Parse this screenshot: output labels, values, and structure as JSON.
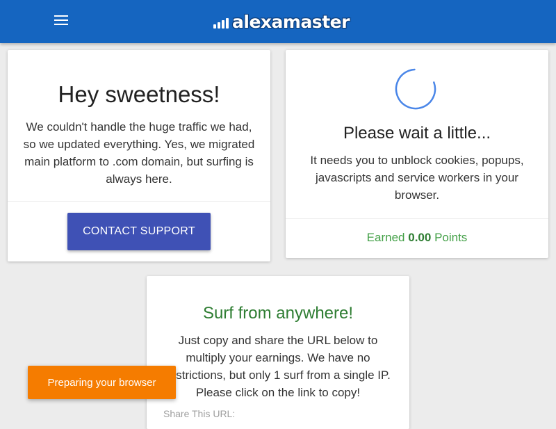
{
  "header": {
    "logo_text": "alexamaster",
    "menu_icon": "hamburger-menu-icon",
    "brand_color": "#1565c0"
  },
  "cards": {
    "welcome": {
      "title": "Hey sweetness!",
      "body": "We couldn't handle the huge traffic we had, so we updated everything. Yes, we migrated main platform to .com domain, but surfing is always here.",
      "button_label": "CONTACT SUPPORT",
      "button_color": "#3f51b5"
    },
    "wait": {
      "spinner_icon": "loading-spinner-icon",
      "title": "Please wait a little...",
      "body": "It needs you to unblock cookies, popups, javascripts and service workers in your browser.",
      "earned_prefix": "Earned",
      "earned_value": "0.00",
      "earned_suffix": "Points"
    },
    "surf": {
      "title": "Surf from anywhere!",
      "body": "Just copy and share the URL below to multiply your earnings. We have no restrictions, but only 1 surf from a single IP. Please click on the link to copy!",
      "share_label": "Share This URL:"
    }
  },
  "toast": {
    "text": "Preparing your browser",
    "color": "#f57c00"
  }
}
